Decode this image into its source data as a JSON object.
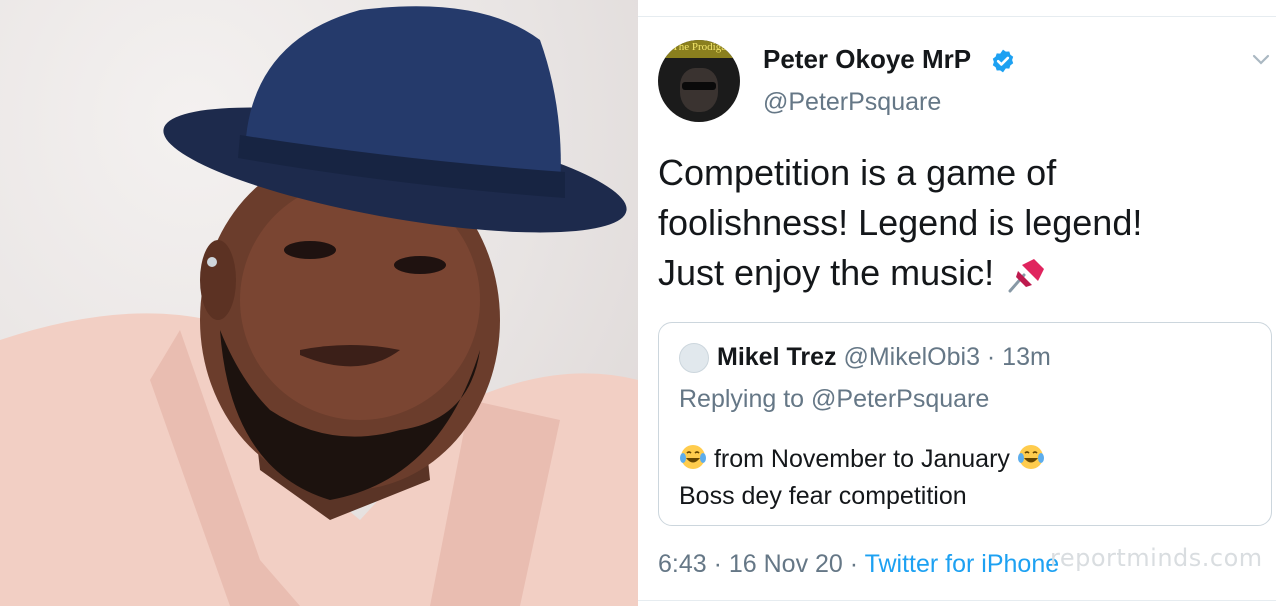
{
  "tweet": {
    "author_name": "Peter Okoye MrP",
    "author_handle": "@PeterPsquare",
    "avatar_caption": "The Prodigal",
    "text_lines": [
      "Competition is a game of",
      "foolishness! Legend is legend!",
      "Just enjoy the music!"
    ],
    "timestamp": "6:43 · 16 Nov 20 · ",
    "source": "Twitter for iPhone"
  },
  "quote": {
    "author_name": "Mikel Trez",
    "author_meta": " @MikelObi3 · 13m",
    "replying_to": "Replying to @PeterPsquare",
    "line1": " from November to January ",
    "line2": "Boss dey fear competition"
  },
  "watermark": "reportminds.com",
  "icons": {
    "verified": "verified-badge-icon",
    "chevron": "chevron-down-icon",
    "pin": "pushpin-icon",
    "laugh": "tears-of-joy-icon"
  },
  "colors": {
    "link": "#1da1f2",
    "muted": "#657786",
    "text": "#14171a",
    "border": "#ccd6dd"
  }
}
